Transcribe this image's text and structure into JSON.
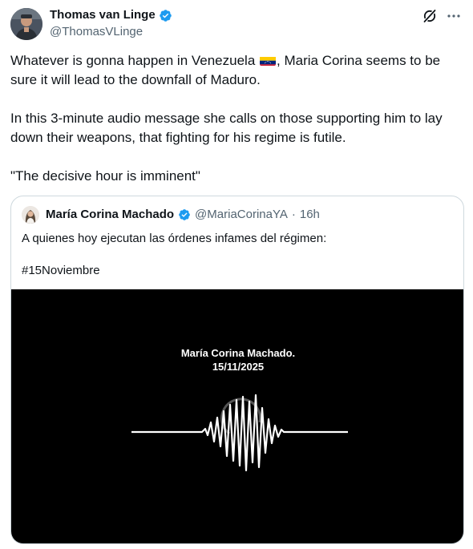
{
  "tweet": {
    "author": {
      "display_name": "Thomas van Linge",
      "handle": "@ThomasVLinge"
    },
    "text": {
      "line1_before_flag": "Whatever is gonna happen in Venezuela",
      "line1_after_flag": ", Maria Corina seems to be sure it will lead to the downfall of Maduro.",
      "paragraph2": "In this 3-minute audio message she calls on those supporting him to lay down their weapons, that fighting for his regime is futile.",
      "paragraph3": "\"The decisive hour is imminent\""
    },
    "icons": {
      "verified": "verified-badge-icon",
      "grok": "grok-icon",
      "more": "more-options-icon",
      "flag": "venezuela-flag-icon"
    }
  },
  "quote": {
    "author": {
      "display_name": "María Corina Machado",
      "handle": "@MariaCorinaYA",
      "separator": "·",
      "time": "16h"
    },
    "text_line1": "A quienes hoy ejecutan las órdenes infames del régimen:",
    "text_line2": "#15Noviembre",
    "media": {
      "title": "María Corina Machado.",
      "date": "15/11/2025"
    }
  },
  "colors": {
    "text": "#0f1419",
    "secondary": "#536471",
    "border": "#cfd9de",
    "verified": "#1d9bf0",
    "media_bg": "#000000"
  }
}
